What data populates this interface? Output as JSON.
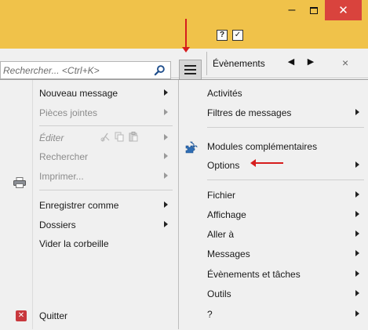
{
  "titlebar": {
    "minimize_glyph": "–",
    "close_glyph": "✕",
    "icon_one_glyph": "?",
    "icon_two_glyph": "✓"
  },
  "search": {
    "placeholder": "Rechercher... <Ctrl+K>"
  },
  "tab": {
    "label": "Évènements",
    "prev_glyph": "◀",
    "next_glyph": "▶",
    "close_glyph": "×"
  },
  "menu_left": [
    {
      "label": "Nouveau message",
      "submenu": true,
      "disabled": false
    },
    {
      "label": "Pièces jointes",
      "submenu": true,
      "disabled": true
    },
    {
      "label": "Éditer",
      "submenu": true,
      "disabled": true
    },
    {
      "label": "Rechercher",
      "submenu": true,
      "disabled": true
    },
    {
      "label": "Imprimer...",
      "submenu": true,
      "disabled": true
    },
    {
      "label": "Enregistrer comme",
      "submenu": true,
      "disabled": false
    },
    {
      "label": "Dossiers",
      "submenu": true,
      "disabled": false
    },
    {
      "label": "Vider la corbeille",
      "submenu": false,
      "disabled": false
    },
    {
      "label": "Quitter",
      "submenu": false,
      "disabled": false
    }
  ],
  "menu_right": [
    {
      "label": "Activités",
      "submenu": false
    },
    {
      "label": "Filtres de messages",
      "submenu": true
    },
    {
      "label": "Modules complémentaires",
      "submenu": false
    },
    {
      "label": "Options",
      "submenu": true
    },
    {
      "label": "Fichier",
      "submenu": true
    },
    {
      "label": "Affichage",
      "submenu": true
    },
    {
      "label": "Aller à",
      "submenu": true
    },
    {
      "label": "Messages",
      "submenu": true
    },
    {
      "label": "Évènements et tâches",
      "submenu": true
    },
    {
      "label": "Outils",
      "submenu": true
    },
    {
      "label": "?",
      "submenu": true
    }
  ],
  "colors": {
    "titlebar": "#f0c24a",
    "close_button": "#d9433d",
    "annotation_arrow": "#d61d1d",
    "menu_background": "#f0f0f0",
    "disabled_text": "#8c8c8c"
  }
}
